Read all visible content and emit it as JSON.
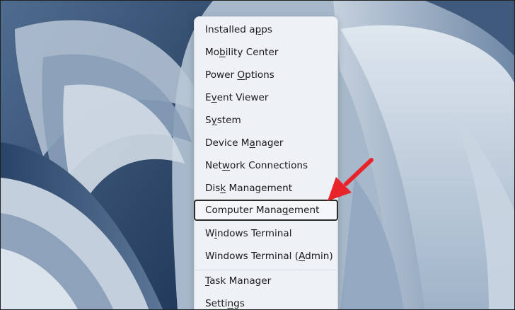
{
  "context_menu": {
    "items": [
      {
        "pre": "Installed a",
        "key": "p",
        "post": "ps"
      },
      {
        "pre": "Mo",
        "key": "b",
        "post": "ility Center"
      },
      {
        "pre": "Power ",
        "key": "O",
        "post": "ptions"
      },
      {
        "pre": "E",
        "key": "v",
        "post": "ent Viewer"
      },
      {
        "pre": "S",
        "key": "y",
        "post": "stem"
      },
      {
        "pre": "Device M",
        "key": "a",
        "post": "nager"
      },
      {
        "pre": "Net",
        "key": "w",
        "post": "ork Connections"
      },
      {
        "pre": "Dis",
        "key": "k",
        "post": " Management"
      },
      {
        "pre": "Computer Mana",
        "key": "g",
        "post": "ement"
      },
      {
        "pre": "W",
        "key": "i",
        "post": "ndows Terminal"
      },
      {
        "pre": "Windows Terminal (",
        "key": "A",
        "post": "dmin)"
      },
      {
        "pre": "",
        "key": "T",
        "post": "ask Manager"
      },
      {
        "pre": "Setti",
        "key": "n",
        "post": "gs"
      }
    ]
  },
  "annotation": {
    "arrow_color": "#e8242b",
    "target": "Computer Management"
  },
  "colors": {
    "menu_bg": "#eef1f5",
    "wallpaper_base": "#a9b9cb"
  }
}
